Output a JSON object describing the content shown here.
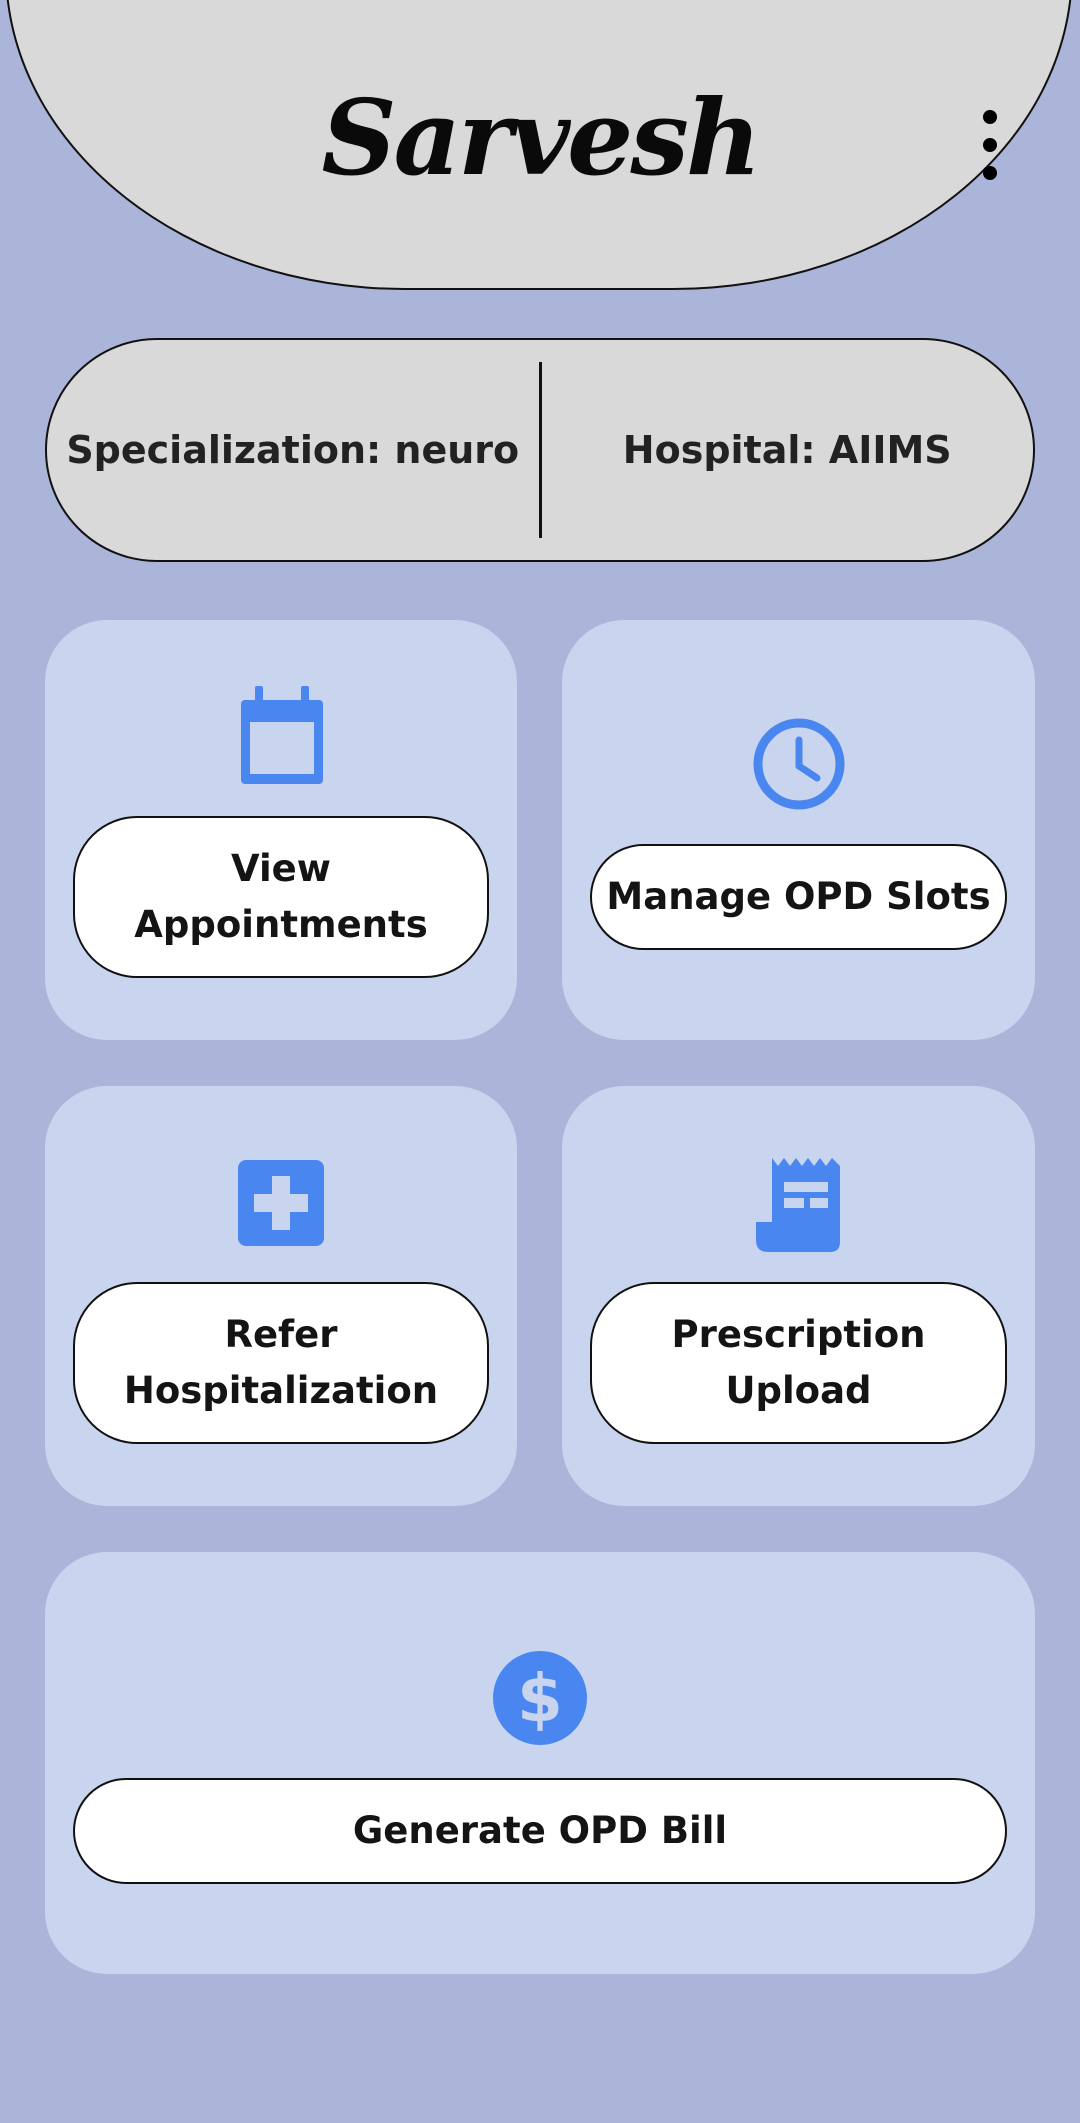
{
  "header": {
    "title": "Sarvesh",
    "menu_icon": "more-vert-icon"
  },
  "info": {
    "specialization": "Specialization: neuro",
    "hospital": "Hospital: AIIMS"
  },
  "actions": [
    {
      "label": "View\nAppointments",
      "icon": "calendar-icon"
    },
    {
      "label": "Manage OPD Slots",
      "icon": "clock-icon"
    },
    {
      "label": "Refer\nHospitalization",
      "icon": "hospital-plus-icon"
    },
    {
      "label": "Prescription\nUpload",
      "icon": "receipt-icon"
    },
    {
      "label": "Generate OPD Bill",
      "icon": "dollar-icon"
    }
  ],
  "colors": {
    "background": "#abb5d9",
    "header": "#d9d9d9",
    "card": "#c9d4ee",
    "icon_accent": "#4a86ef",
    "button": "#ffffff"
  }
}
